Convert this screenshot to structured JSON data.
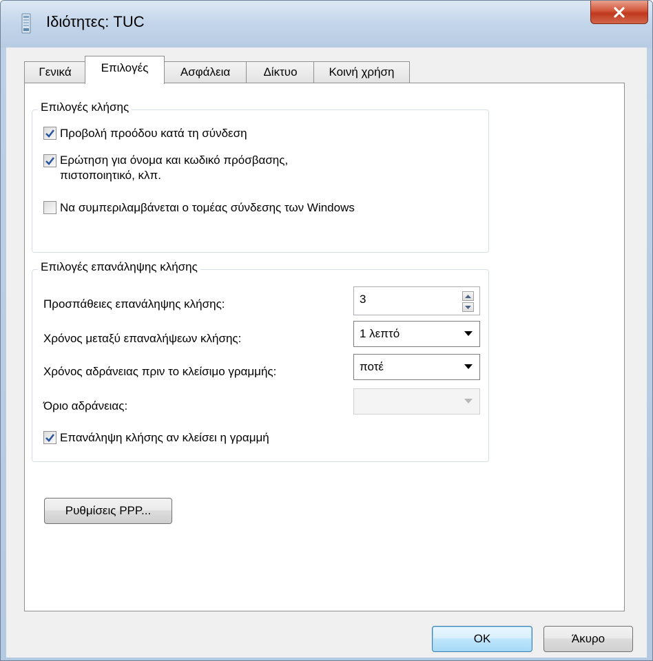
{
  "window": {
    "title": "Ιδιότητες: TUC"
  },
  "tabs": [
    {
      "label": "Γενικά"
    },
    {
      "label": "Επιλογές"
    },
    {
      "label": "Ασφάλεια"
    },
    {
      "label": "Δίκτυο"
    },
    {
      "label": "Κοινή χρήση"
    }
  ],
  "active_tab": "Επιλογές",
  "dialing_options": {
    "legend": "Επιλογές κλήσης",
    "show_progress": {
      "label": "Προβολή προόδου κατά τη σύνδεση",
      "checked": true
    },
    "prompt_credentials": {
      "label": "Ερώτηση για όνομα και κωδικό πρόσβασης,\nπιστοποιητικό, κλπ.",
      "checked": true
    },
    "include_domain": {
      "label": "Να συμπεριλαμβάνεται ο τομέας σύνδεσης των Windows",
      "checked": false
    }
  },
  "redial_options": {
    "legend": "Επιλογές επανάληψης κλήσης",
    "redial_attempts": {
      "label": "Προσπάθειες επανάληψης κλήσης:",
      "value": "3"
    },
    "time_between": {
      "label": "Χρόνος μεταξύ επαναλήψεων κλήσης:",
      "value": "1 λεπτό"
    },
    "idle_before_hangup": {
      "label": "Χρόνος αδράνειας πριν το κλείσιμο γραμμής:",
      "value": "ποτέ"
    },
    "idle_threshold": {
      "label": "Όριο αδράνειας:",
      "value": ""
    },
    "redial_if_dropped": {
      "label": "Επανάληψη κλήσης αν κλείσει η γραμμή",
      "checked": true
    }
  },
  "ppp_button": "Ρυθμίσεις PPP...",
  "footer": {
    "ok": "OK",
    "cancel": "Άκυρο"
  }
}
